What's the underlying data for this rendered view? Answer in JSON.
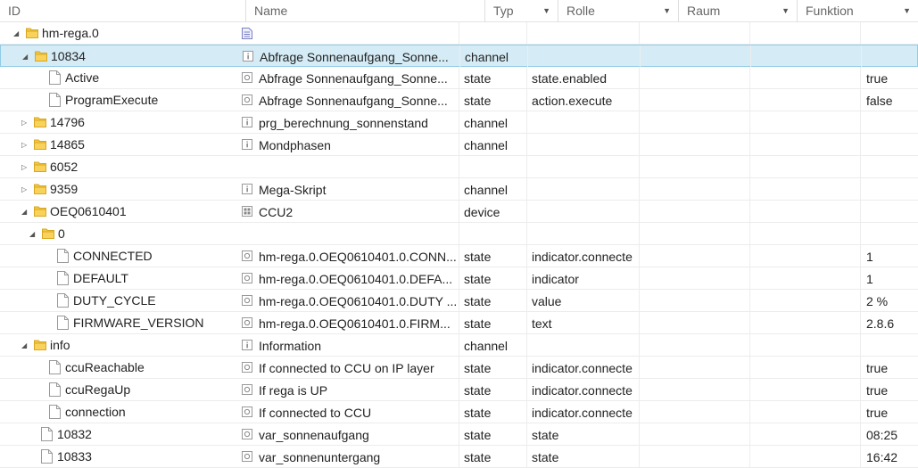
{
  "columns": {
    "id": "ID",
    "name": "Name",
    "typ": "Typ",
    "rolle": "Rolle",
    "raum": "Raum",
    "funktion": "Funktion"
  },
  "rows": [
    {
      "id": "hm-rega.0",
      "name": "",
      "typ": "",
      "rolle": "",
      "value": "",
      "level": 0,
      "kind": "folder",
      "expanded": true,
      "name_icon": "script-icon"
    },
    {
      "id": "10834",
      "name": "Abfrage Sonnenaufgang_Sonne...",
      "typ": "channel",
      "rolle": "",
      "value": "",
      "level": 1,
      "kind": "folder",
      "expanded": true,
      "name_icon": "info-icon",
      "selected": true
    },
    {
      "id": "Active",
      "name": "Abfrage Sonnenaufgang_Sonne...",
      "typ": "state",
      "rolle": "state.enabled",
      "value": "true",
      "level": 2,
      "kind": "file",
      "name_icon": "state-icon"
    },
    {
      "id": "ProgramExecute",
      "name": "Abfrage Sonnenaufgang_Sonne...",
      "typ": "state",
      "rolle": "action.execute",
      "value": "false",
      "level": 2,
      "kind": "file",
      "name_icon": "state-icon"
    },
    {
      "id": "14796",
      "name": "prg_berechnung_sonnenstand",
      "typ": "channel",
      "rolle": "",
      "value": "",
      "level": 1,
      "kind": "folder",
      "expanded": false,
      "name_icon": "info-icon"
    },
    {
      "id": "14865",
      "name": "Mondphasen",
      "typ": "channel",
      "rolle": "",
      "value": "",
      "level": 1,
      "kind": "folder",
      "expanded": false,
      "name_icon": "info-icon"
    },
    {
      "id": "6052",
      "name": "",
      "typ": "",
      "rolle": "",
      "value": "",
      "level": 1,
      "kind": "folder",
      "expanded": false,
      "name_icon": ""
    },
    {
      "id": "9359",
      "name": "Mega-Skript",
      "typ": "channel",
      "rolle": "",
      "value": "",
      "level": 1,
      "kind": "folder",
      "expanded": false,
      "name_icon": "info-icon"
    },
    {
      "id": "OEQ0610401",
      "name": "CCU2",
      "typ": "device",
      "rolle": "",
      "value": "",
      "level": 1,
      "kind": "folder",
      "expanded": true,
      "name_icon": "device-icon"
    },
    {
      "id": "0",
      "name": "",
      "typ": "",
      "rolle": "",
      "value": "",
      "level": 2,
      "kind": "folder",
      "expanded": true,
      "name_icon": ""
    },
    {
      "id": "CONNECTED",
      "name": "hm-rega.0.OEQ0610401.0.CONN...",
      "typ": "state",
      "rolle": "indicator.connecte",
      "value": "1",
      "level": 3,
      "kind": "file",
      "name_icon": "state-icon"
    },
    {
      "id": "DEFAULT",
      "name": "hm-rega.0.OEQ0610401.0.DEFA...",
      "typ": "state",
      "rolle": "indicator",
      "value": "1",
      "level": 3,
      "kind": "file",
      "name_icon": "state-icon"
    },
    {
      "id": "DUTY_CYCLE",
      "name": "hm-rega.0.OEQ0610401.0.DUTY ...",
      "typ": "state",
      "rolle": "value",
      "value": "2 %",
      "level": 3,
      "kind": "file",
      "name_icon": "state-icon"
    },
    {
      "id": "FIRMWARE_VERSION",
      "name": "hm-rega.0.OEQ0610401.0.FIRM...",
      "typ": "state",
      "rolle": "text",
      "value": "2.8.6",
      "level": 3,
      "kind": "file",
      "name_icon": "state-icon"
    },
    {
      "id": "info",
      "name": "Information",
      "typ": "channel",
      "rolle": "",
      "value": "",
      "level": 1,
      "kind": "folder",
      "expanded": true,
      "name_icon": "info-icon"
    },
    {
      "id": "ccuReachable",
      "name": "If connected to CCU on IP layer",
      "typ": "state",
      "rolle": "indicator.connecte",
      "value": "true",
      "level": 2,
      "kind": "file",
      "name_icon": "state-icon"
    },
    {
      "id": "ccuRegaUp",
      "name": "If rega is UP",
      "typ": "state",
      "rolle": "indicator.connecte",
      "value": "true",
      "level": 2,
      "kind": "file",
      "name_icon": "state-icon"
    },
    {
      "id": "connection",
      "name": "If connected to CCU",
      "typ": "state",
      "rolle": "indicator.connecte",
      "value": "true",
      "level": 2,
      "kind": "file",
      "name_icon": "state-icon"
    },
    {
      "id": "10832",
      "name": "var_sonnenaufgang",
      "typ": "state",
      "rolle": "state",
      "value": "08:25",
      "level": 1,
      "kind": "file",
      "name_icon": "state-icon"
    },
    {
      "id": "10833",
      "name": "var_sonnenuntergang",
      "typ": "state",
      "rolle": "state",
      "value": "16:42",
      "level": 1,
      "kind": "file",
      "name_icon": "state-icon"
    }
  ]
}
